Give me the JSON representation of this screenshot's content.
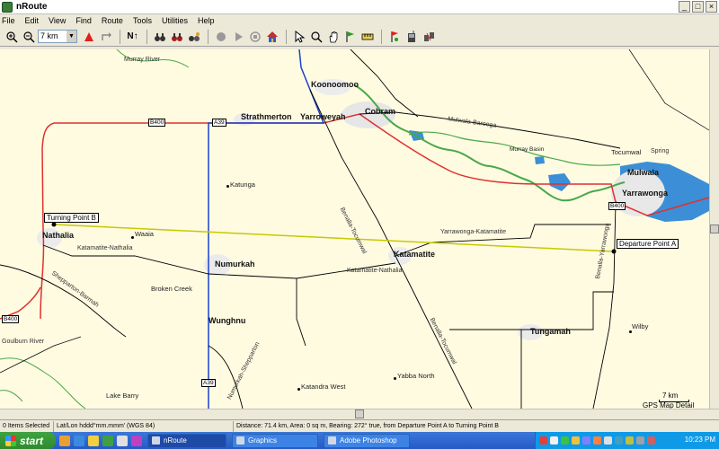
{
  "window": {
    "title": "nRoute",
    "btn_minimize": "_",
    "btn_maximize": "□",
    "btn_close": "×"
  },
  "menu": [
    "File",
    "Edit",
    "View",
    "Find",
    "Route",
    "Tools",
    "Utilities",
    "Help"
  ],
  "toolbar": {
    "scale_value": "7 km",
    "north_label": "N↑",
    "scale_arrow": "▼"
  },
  "map": {
    "towns_major": [
      {
        "name": "Koonoomoo"
      },
      {
        "name": "Cobram"
      },
      {
        "name": "Strathmerton"
      },
      {
        "name": "Yarroweyah"
      },
      {
        "name": "Mulwala"
      },
      {
        "name": "Yarrawonga"
      },
      {
        "name": "Nathalia"
      },
      {
        "name": "Numurkah"
      },
      {
        "name": "Katamatite"
      },
      {
        "name": "Wunghnu"
      },
      {
        "name": "Tungamah"
      }
    ],
    "towns_minor": [
      {
        "name": "Katunga"
      },
      {
        "name": "Waaia"
      },
      {
        "name": "Broken Creek"
      },
      {
        "name": "Katandra West"
      },
      {
        "name": "Yabba North"
      },
      {
        "name": "Wilby"
      },
      {
        "name": "Lake Barry"
      },
      {
        "name": "Murray Basin"
      },
      {
        "name": "Tocumwal"
      }
    ],
    "rivers": [
      {
        "name": "Murray River"
      },
      {
        "name": "Goulburn River"
      },
      {
        "name": "Spring"
      }
    ],
    "roads": [
      {
        "name": "Mulwala-Barooga"
      },
      {
        "name": "Benalla-Tocumwal"
      },
      {
        "name": "Katamatite-Nathalia"
      },
      {
        "name": "Yarrawonga-Katamatite"
      },
      {
        "name": "Shepparton-Barmah"
      },
      {
        "name": "Numurkah-Shepparton"
      },
      {
        "name": "Benalla-Yarrawonga"
      },
      {
        "name": "Benalla-Tocumwal"
      },
      {
        "name": "Katamatite-Nathalia"
      }
    ],
    "shields": [
      "B400",
      "A39",
      "B400",
      "B400",
      "A39"
    ],
    "points": {
      "turning": "Turning Point B",
      "departure": "Departure Point A"
    },
    "scale": {
      "label": "7 km",
      "detail": "GPS Map Detail"
    }
  },
  "status": {
    "items_selected": "0 Items Selected",
    "coordinate_format": "Lat/Lon hddd°mm.mmm' (WGS 84)",
    "measurement": "Distance: 71.4 km, Area: 0 sq m, Bearing: 272° true, from Departure Point A to Turning Point B"
  },
  "taskbar": {
    "start_label": "start",
    "tasks": [
      {
        "label": "nRoute",
        "active": true
      },
      {
        "label": "Graphics",
        "active": false
      },
      {
        "label": "Adobe Photoshop",
        "active": false
      }
    ],
    "clock": "10:23 PM"
  },
  "colors": {
    "map_bg": "#fffbe1",
    "highway_red": "#e03030",
    "highway_blue": "#1a3fcf",
    "water": "#3c8fd6",
    "route_yellow": "#c8c800",
    "road_black": "#000000"
  }
}
